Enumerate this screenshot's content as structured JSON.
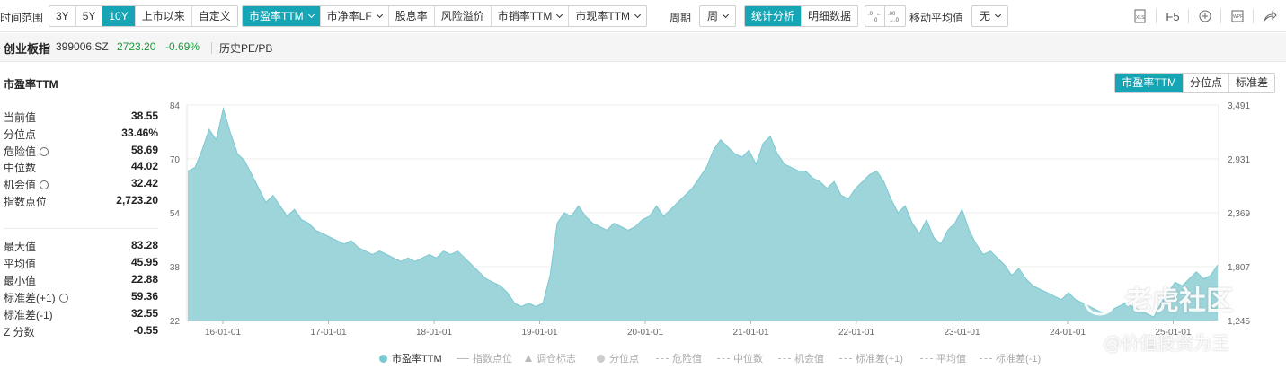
{
  "toolbar": {
    "time_range_label": "时间范围",
    "range_buttons": [
      "3Y",
      "5Y",
      "10Y",
      "上市以来",
      "自定义"
    ],
    "metric_buttons": [
      "市盈率TTM",
      "市净率LF",
      "股息率",
      "风险溢价",
      "市销率TTM",
      "市现率TTM"
    ],
    "period_label": "周期",
    "period_value": "周",
    "analysis_buttons": [
      "统计分析",
      "明细数据"
    ],
    "ma_label": "移动平均值",
    "ma_value": "无",
    "right_icons": [
      "xls-icon",
      "F5",
      "plus-circle-icon",
      "image-icon",
      "share-icon"
    ],
    "f5_label": "F5"
  },
  "header": {
    "name": "创业板指",
    "code": "399006.SZ",
    "price": "2723.20",
    "change": "-0.69%",
    "history_link": "历史PE/PB"
  },
  "panel": {
    "title": "市盈率TTM",
    "stats_top": [
      {
        "label": "当前值",
        "value": "38.55",
        "gear": false
      },
      {
        "label": "分位点",
        "value": "33.46%",
        "gear": false
      },
      {
        "label": "危险值",
        "value": "58.69",
        "gear": true
      },
      {
        "label": "中位数",
        "value": "44.02",
        "gear": false
      },
      {
        "label": "机会值",
        "value": "32.42",
        "gear": true
      },
      {
        "label": "指数点位",
        "value": "2,723.20",
        "gear": false
      }
    ],
    "stats_bottom": [
      {
        "label": "最大值",
        "value": "83.28",
        "gear": false
      },
      {
        "label": "平均值",
        "value": "45.95",
        "gear": false
      },
      {
        "label": "最小值",
        "value": "22.88",
        "gear": false
      },
      {
        "label": "标准差(+1)",
        "value": "59.36",
        "gear": true
      },
      {
        "label": "标准差(-1)",
        "value": "32.55",
        "gear": false
      },
      {
        "label": "Z 分数",
        "value": "-0.55",
        "gear": false
      }
    ]
  },
  "chart_tabs": [
    "市盈率TTM",
    "分位点",
    "标准差"
  ],
  "legend": {
    "items": [
      "市盈率TTM",
      "指数点位",
      "调仓标志",
      "分位点",
      "危险值",
      "中位数",
      "机会值",
      "标准差(+1)",
      "平均值",
      "标准差(-1)"
    ]
  },
  "watermark": {
    "brand": "老虎社区",
    "handle": "@价值投资为王"
  },
  "colors": {
    "accent": "#15a5b5",
    "area_fill": "#9dd5db",
    "area_line": "#7cc8d1",
    "down": "#1a9b3a"
  },
  "chart_data": {
    "type": "area",
    "series": [
      {
        "name": "市盈率TTM",
        "values": [
          65,
          66,
          71,
          77,
          74,
          83,
          76,
          70,
          68,
          64,
          60,
          56,
          58,
          55,
          52,
          54,
          51,
          50,
          48,
          47,
          46,
          45,
          44,
          45,
          43,
          42,
          41,
          42,
          41,
          40,
          39,
          40,
          39,
          40,
          41,
          40,
          42,
          41,
          42,
          40,
          38,
          36,
          34,
          33,
          32,
          30,
          27,
          26,
          27,
          26,
          27,
          35,
          50,
          53,
          52,
          55,
          52,
          50,
          49,
          48,
          50,
          49,
          48,
          49,
          51,
          52,
          55,
          52,
          54,
          56,
          58,
          60,
          63,
          66,
          71,
          74,
          72,
          70,
          69,
          71,
          67,
          73,
          75,
          70,
          67,
          66,
          65,
          65,
          63,
          62,
          60,
          62,
          58,
          57,
          60,
          62,
          64,
          65,
          62,
          57,
          53,
          55,
          50,
          47,
          51,
          46,
          44,
          48,
          50,
          54,
          48,
          44,
          41,
          42,
          40,
          38,
          35,
          37,
          34,
          32,
          31,
          30,
          29,
          28,
          30,
          28,
          27,
          26,
          25,
          24,
          25,
          26,
          27,
          26,
          25,
          24,
          23,
          27,
          30,
          33,
          32,
          34,
          36,
          34,
          35,
          38
        ]
      }
    ],
    "x_ticks": [
      "16-01-01",
      "17-01-01",
      "18-01-01",
      "19-01-01",
      "20-01-01",
      "21-01-01",
      "22-01-01",
      "23-01-01",
      "24-01-01",
      "25-01-01"
    ],
    "y_left_ticks": [
      "84",
      "70",
      "54",
      "38",
      "22"
    ],
    "y_right_ticks": [
      "3,491",
      "2,931",
      "2,369",
      "1,807",
      "1,245"
    ],
    "ylim": [
      22,
      84
    ],
    "grid": true
  }
}
